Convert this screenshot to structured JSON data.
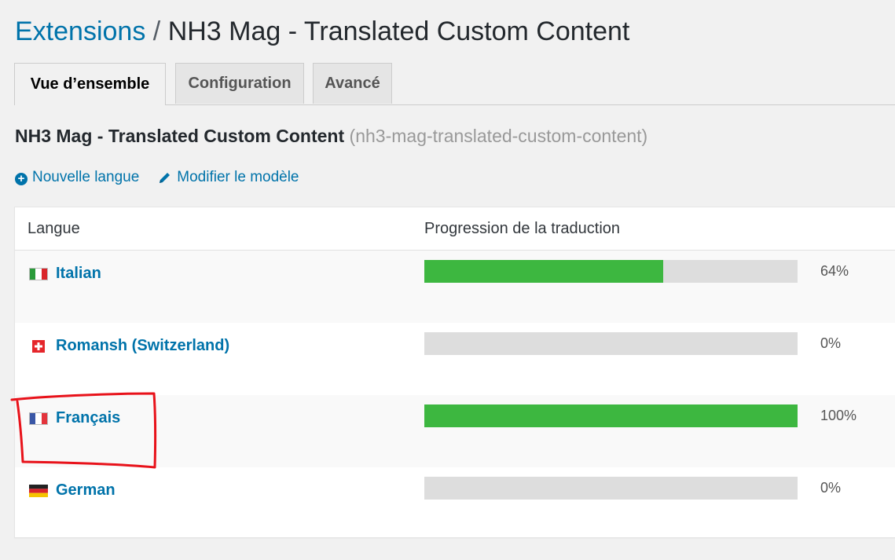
{
  "header": {
    "breadcrumb_link": "Extensions",
    "separator": "/",
    "title": "NH3 Mag - Translated Custom Content"
  },
  "tabs": [
    {
      "label": "Vue d’ensemble",
      "active": true
    },
    {
      "label": "Configuration",
      "active": false
    },
    {
      "label": "Avancé",
      "active": false
    }
  ],
  "section": {
    "name": "NH3 Mag - Translated Custom Content",
    "slug": "(nh3-mag-translated-custom-content)"
  },
  "actions": {
    "new_language": "Nouvelle langue",
    "edit_template": "Modifier le modèle"
  },
  "table": {
    "headers": {
      "language": "Langue",
      "progress": "Progression de la traduction"
    },
    "rows": [
      {
        "language": "Italian",
        "flag": "it-flag-icon",
        "progress": 64,
        "progress_label": "64%"
      },
      {
        "language": "Romansh (Switzerland)",
        "flag": "ch-flag-icon",
        "progress": 0,
        "progress_label": "0%"
      },
      {
        "language": "Français",
        "flag": "fr-flag-icon",
        "progress": 100,
        "progress_label": "100%"
      },
      {
        "language": "German",
        "flag": "de-flag-icon",
        "progress": 0,
        "progress_label": "0%"
      }
    ]
  },
  "colors": {
    "link": "#0073aa",
    "progress_fill": "#3db740",
    "progress_track": "#dddddd",
    "highlight": "#e8121a"
  }
}
